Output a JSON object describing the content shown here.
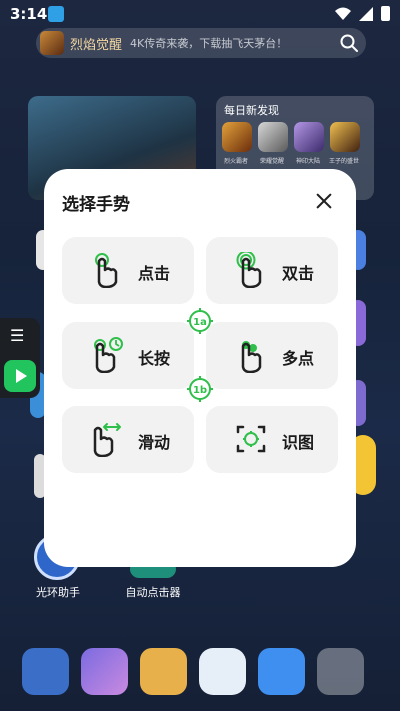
{
  "status_bar": {
    "time": "3:14"
  },
  "search_bar": {
    "game_name": "烈焰觉醒",
    "promo_text": "4K传奇来袭，下载抽飞天茅台！"
  },
  "discover_widget": {
    "title": "每日新发现",
    "apps": [
      "烈火霸者",
      "荣耀觉醒",
      "神印大陆",
      "王子的盛世"
    ]
  },
  "home_labels": {
    "app1": "光环助手",
    "app2": "自动点击器"
  },
  "dialog": {
    "title": "选择手势",
    "options": [
      {
        "label": "点击",
        "icon": "tap-gesture-icon"
      },
      {
        "label": "双击",
        "icon": "double-tap-gesture-icon"
      },
      {
        "label": "长按",
        "icon": "long-press-gesture-icon"
      },
      {
        "label": "多点",
        "icon": "multi-touch-gesture-icon"
      },
      {
        "label": "滑动",
        "icon": "swipe-gesture-icon"
      },
      {
        "label": "识图",
        "icon": "image-recognition-icon"
      }
    ],
    "markers": [
      "1a",
      "1b"
    ],
    "accent_color": "#2fbf4a"
  },
  "colors": {
    "accent": "#2fbf4a",
    "dialog_bg": "#ffffff",
    "option_bg": "#f2f2f2"
  }
}
